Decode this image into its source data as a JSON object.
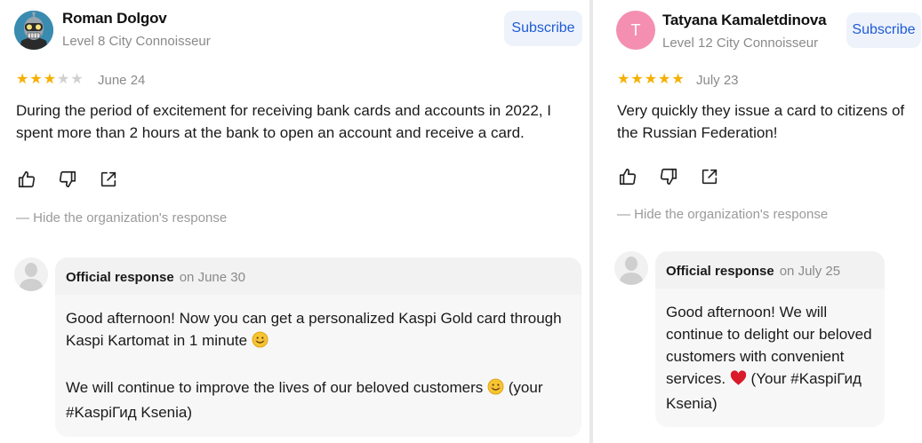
{
  "left": {
    "name": "Roman Dolgov",
    "level": "Level 8 City Connoisseur",
    "subscribe": "Subscribe",
    "rating": 3,
    "date": "June 24",
    "text": "During the period of excitement for receiving bank cards and accounts in 2022, I spent more than 2 hours at the bank to open an account and receive a card.",
    "hide_response": "— Hide the organization's response",
    "response": {
      "label": "Official response",
      "date": "on June 30",
      "p1": "Good afternoon! Now you can get a personalized Kaspi Gold card through Kaspi Kartomat in 1 minute",
      "p2a": "We will continue to improve the lives of our beloved customers",
      "p2b": "(your #KaspiГид Ksenia)"
    }
  },
  "right": {
    "name": "Tatyana Kamaletdinova",
    "avatar_letter": "T",
    "level": "Level 12 City Connoisseur",
    "subscribe": "Subscribe",
    "rating": 5,
    "date": "July 23",
    "text": "Very quickly they issue a card to citizens of the Russian Federation!",
    "hide_response": "— Hide the organization's response",
    "response": {
      "label": "Official response",
      "date": "on July 25",
      "p1a": "Good afternoon! We will continue to delight our beloved customers with convenient services.",
      "p1b": "(Your #KaspiГид Ksenia)"
    }
  },
  "colors": {
    "star_on": "#f5b000",
    "star_off": "#d0d0d0",
    "subscribe_text": "#1f5bd6",
    "subscribe_bg": "#eef3fb",
    "avatar_pink": "#f48fb1"
  },
  "icons": [
    "thumbs-up-icon",
    "thumbs-down-icon",
    "share-icon",
    "smile-emoji-icon",
    "heart-emoji-icon",
    "robot-avatar-icon",
    "organization-avatar-icon"
  ]
}
